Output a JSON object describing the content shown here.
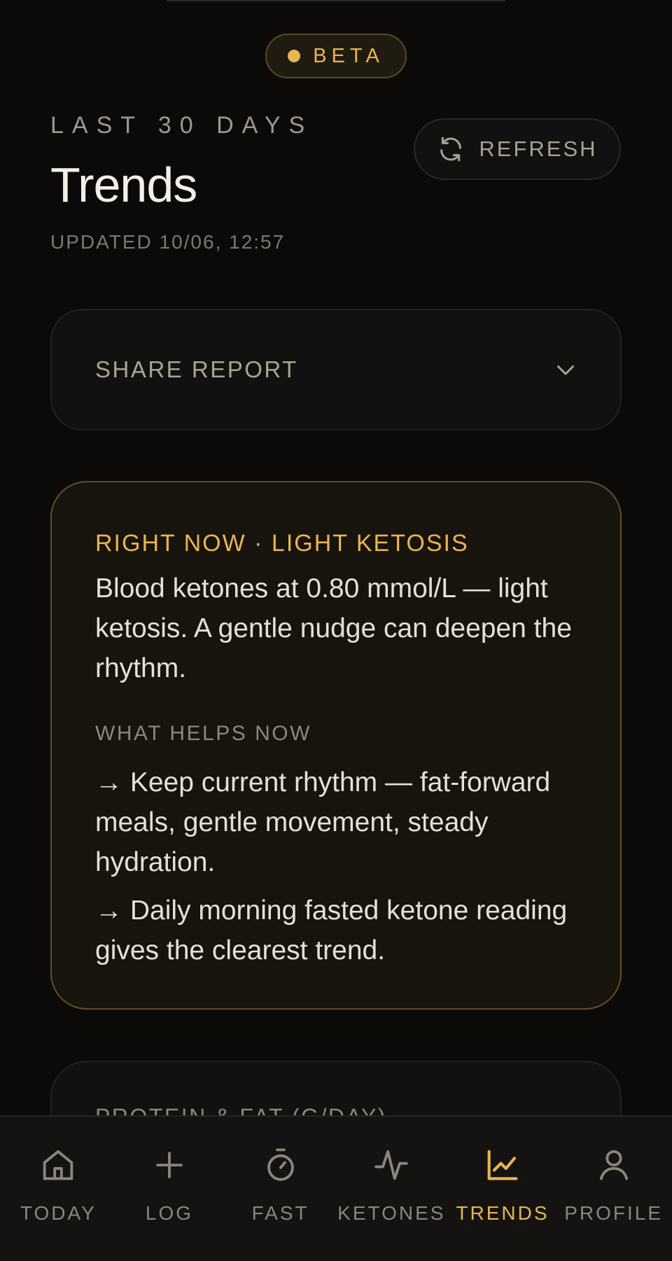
{
  "beta_badge": {
    "label": "BETA"
  },
  "header": {
    "eyebrow": "LAST 30 DAYS",
    "title": "Trends",
    "updated": "UPDATED 10/06, 12:57",
    "refresh_label": "REFRESH"
  },
  "share_report": {
    "label": "SHARE REPORT"
  },
  "insight": {
    "eyebrow": "RIGHT NOW · LIGHT KETOSIS",
    "body": "Blood ketones at 0.80 mmol/L — light ketosis. A gentle nudge can deepen the rhythm.",
    "helps_label": "WHAT HELPS NOW",
    "tips": [
      "→ Keep current rhythm — fat-forward meals, gentle movement, steady hydration.",
      "→ Daily morning fasted ketone reading gives the clearest trend."
    ]
  },
  "protein_card": {
    "title": "PROTEIN & FAT (G/DAY)"
  },
  "nav": {
    "items": [
      {
        "label": "TODAY",
        "icon": "home-icon",
        "active": false
      },
      {
        "label": "LOG",
        "icon": "plus-icon",
        "active": false
      },
      {
        "label": "FAST",
        "icon": "stopwatch-icon",
        "active": false
      },
      {
        "label": "KETONES",
        "icon": "pulse-icon",
        "active": false
      },
      {
        "label": "TRENDS",
        "icon": "chart-icon",
        "active": true
      },
      {
        "label": "PROFILE",
        "icon": "person-icon",
        "active": false
      }
    ]
  },
  "colors": {
    "background": "#0b0a09",
    "accent": "#e9b54f",
    "card_border_accent": "#6b4d1e",
    "muted_text": "#8a857d"
  }
}
